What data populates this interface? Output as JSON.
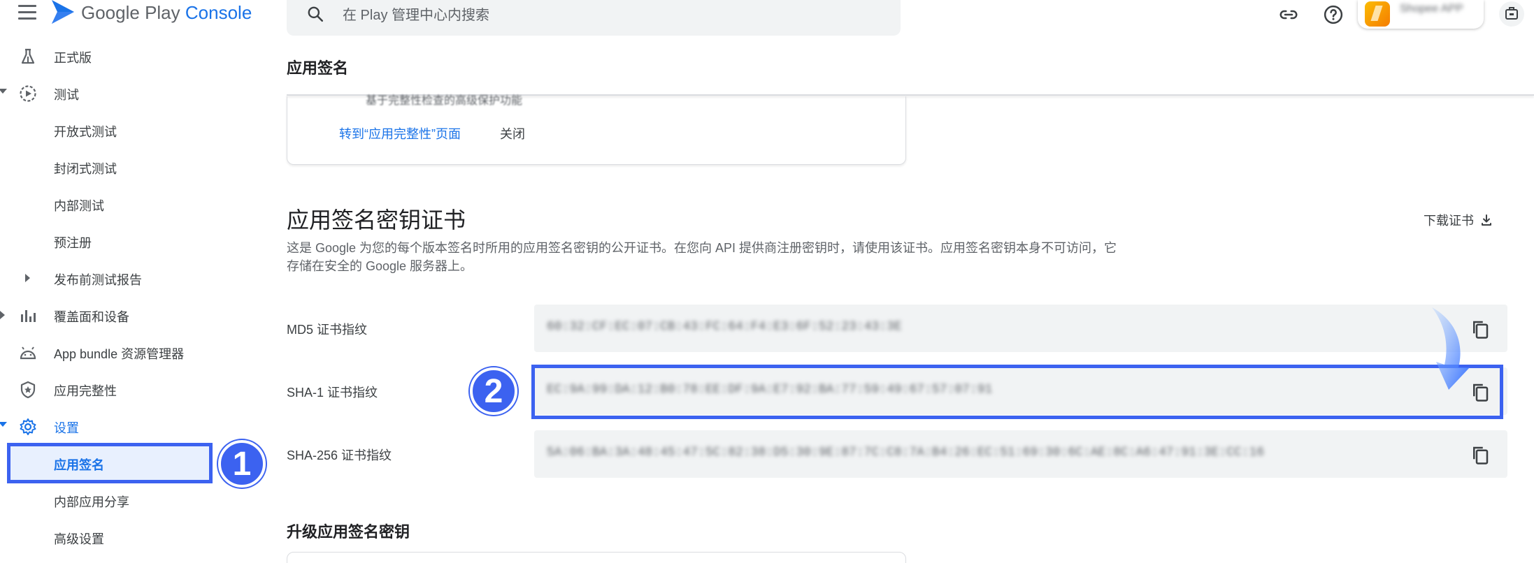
{
  "header": {
    "brand_google_play": "Google Play",
    "brand_console": "Console",
    "search_placeholder": "在 Play 管理中心内搜索",
    "account_name": "Shopee APP"
  },
  "sidebar": {
    "items": [
      {
        "label": "正式版"
      },
      {
        "label": "测试"
      },
      {
        "label": "开放式测试"
      },
      {
        "label": "封闭式测试"
      },
      {
        "label": "内部测试"
      },
      {
        "label": "预注册"
      },
      {
        "label": "发布前测试报告"
      },
      {
        "label": "覆盖面和设备"
      },
      {
        "label": "App bundle 资源管理器"
      },
      {
        "label": "应用完整性"
      },
      {
        "label": "设置"
      },
      {
        "label": "应用签名"
      },
      {
        "label": "内部应用分享"
      },
      {
        "label": "高级设置"
      }
    ]
  },
  "annotations": {
    "step1": "1",
    "step2": "2"
  },
  "main": {
    "page_title": "应用签名",
    "card_clipped_text": "基于完整性检查的高级保护功能",
    "card_link": "转到“应用完整性”页面",
    "card_close": "关闭",
    "section_title": "应用签名密钥证书",
    "download_label": "下载证书",
    "description": "这是 Google 为您的每个版本签名时所用的应用签名密钥的公开证书。在您向 API 提供商注册密钥时，请使用该证书。应用签名密钥本身不可访问，它存储在安全的 Google 服务器上。",
    "fingerprints": [
      {
        "label": "MD5 证书指纹",
        "value": "60:32:CF:EC:07:CB:43:FC:64:F4:E3:6F:52:23:43:3E"
      },
      {
        "label": "SHA-1 证书指纹",
        "value": "EC:9A:99:DA:12:B0:78:EE:DF:9A:E7:92:BA:77:59:49:67:57:07:91"
      },
      {
        "label": "SHA-256 证书指纹",
        "value": "5A:06:BA:3A:48:45:47:5C:82:38:D5:30:9E:87:7C:C8:7A:B4:26:EC:51:69:30:6C:AE:8C:A6:47:91:3E:CC:16"
      }
    ],
    "upgrade_title": "升级应用签名密钥"
  },
  "colors": {
    "accent": "#1a73e8",
    "annotation": "#3c62f0"
  }
}
